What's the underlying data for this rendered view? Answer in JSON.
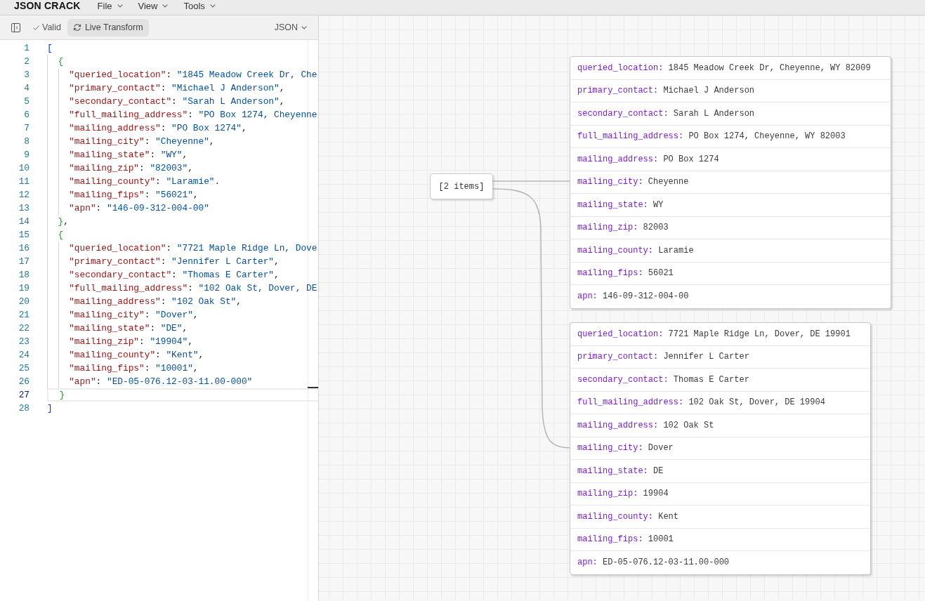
{
  "app_bar": {
    "logo": "JSON CRACK",
    "menus": [
      "File",
      "View",
      "Tools"
    ]
  },
  "editor": {
    "toolbar": {
      "status": "Valid",
      "live_transform": {
        "label": "Live Transform",
        "on": true
      },
      "format": "JSON"
    },
    "code": [
      {
        "number": "1",
        "text": "[",
        "current": false,
        "children": [
          {
            "number": "2",
            "text": "{",
            "current": false,
            "children": [
              {
                "number": "3",
                "text": "\"queried_location\": \"1845 Meadow Creek Dr, Che",
                "current": false
              },
              {
                "number": "4",
                "text": "\"primary_contact\": \"Michael J Anderson\",",
                "current": false
              },
              {
                "number": "5",
                "text": "\"secondary_contact\": \"Sarah L Anderson\",",
                "current": false
              },
              {
                "number": "6",
                "text": "\"full_mailing_address\": \"PO Box 1274, Cheyenne",
                "current": false
              },
              {
                "number": "7",
                "text": "\"mailing_address\": \"PO Box 1274\",",
                "current": false
              },
              {
                "number": "8",
                "text": "\"mailing_city\": \"Cheyenne\",",
                "current": false
              },
              {
                "number": "9",
                "text": "\"mailing_state\": \"WY\",",
                "current": false
              },
              {
                "number": "10",
                "text": "\"mailing_zip\": \"82003\",",
                "current": false
              },
              {
                "number": "11",
                "text": "\"mailing_county\": \"Laramie\".",
                "current": false
              },
              {
                "number": "12",
                "text": "\"mailing_fips\": \"56021\",",
                "current": false
              },
              {
                "number": "13",
                "text": "\"apn\": \"146-09-312-004-00\"",
                "current": false
              }
            ]
          },
          {
            "number": "14",
            "text": "},",
            "current": false
          },
          {
            "number": "15",
            "text": "{",
            "current": false,
            "children": [
              {
                "number": "16",
                "text": "\"queried_location\": \"7721 Maple Ridge Ln, Dove",
                "current": false
              },
              {
                "number": "17",
                "text": "\"primary_contact\": \"Jennifer L Carter\",",
                "current": false
              },
              {
                "number": "18",
                "text": "\"secondary_contact\": \"Thomas E Carter\",",
                "current": false
              },
              {
                "number": "19",
                "text": "\"full_mailing_address\": \"102 Oak St, Dover, DE",
                "current": false
              },
              {
                "number": "20",
                "text": "\"mailing_address\": \"102 Oak St\",",
                "current": false
              },
              {
                "number": "21",
                "text": "\"mailing_city\": \"Dover\",",
                "current": false
              },
              {
                "number": "22",
                "text": "\"mailing_state\": \"DE\",",
                "current": false
              },
              {
                "number": "23",
                "text": "\"mailing_zip\": \"19904\",",
                "current": false
              },
              {
                "number": "24",
                "text": "\"mailing_county\": \"Kent\",",
                "current": false
              },
              {
                "number": "25",
                "text": "\"mailing_fips\": \"10001\",",
                "current": false
              },
              {
                "number": "26",
                "text": "\"apn\": \"ED-05-076.12-03-11.00-000\"",
                "current": false
              }
            ]
          },
          {
            "number": "27",
            "text": "}",
            "current": true
          }
        ]
      },
      {
        "number": "28",
        "text": "]",
        "current": false
      }
    ]
  },
  "graph": {
    "nodes": [
      {
        "kind": "array",
        "label": "[2 items]"
      },
      {
        "kind": "object",
        "rows": [
          {
            "key": "queried_location:",
            "value": "1845 Meadow Creek Dr, Cheyenne, WY 82009"
          },
          {
            "key": "primary_contact:",
            "value": "Michael J Anderson"
          },
          {
            "key": "secondary_contact:",
            "value": "Sarah L Anderson"
          },
          {
            "key": "full_mailing_address:",
            "value": "PO Box 1274, Cheyenne, WY 82003"
          },
          {
            "key": "mailing_address:",
            "value": "PO Box 1274"
          },
          {
            "key": "mailing_city:",
            "value": "Cheyenne"
          },
          {
            "key": "mailing_state:",
            "value": "WY"
          },
          {
            "key": "mailing_zip:",
            "value": "82003"
          },
          {
            "key": "mailing_county:",
            "value": "Laramie"
          },
          {
            "key": "mailing_fips:",
            "value": "56021"
          },
          {
            "key": "apn:",
            "value": "146-09-312-004-00"
          }
        ]
      },
      {
        "kind": "object",
        "rows": [
          {
            "key": "queried_location:",
            "value": "7721 Maple Ridge Ln, Dover, DE 19901"
          },
          {
            "key": "primary_contact:",
            "value": "Jennifer L Carter"
          },
          {
            "key": "secondary_contact:",
            "value": "Thomas E Carter"
          },
          {
            "key": "full_mailing_address:",
            "value": "102 Oak St, Dover, DE 19904"
          },
          {
            "key": "mailing_address:",
            "value": "102 Oak St"
          },
          {
            "key": "mailing_city:",
            "value": "Dover"
          },
          {
            "key": "mailing_state:",
            "value": "DE"
          },
          {
            "key": "mailing_zip:",
            "value": "19904"
          },
          {
            "key": "mailing_county:",
            "value": "Kent"
          },
          {
            "key": "mailing_fips:",
            "value": "10001"
          },
          {
            "key": "apn:",
            "value": "ED-05-076.12-03-11.00-000"
          }
        ]
      }
    ]
  }
}
